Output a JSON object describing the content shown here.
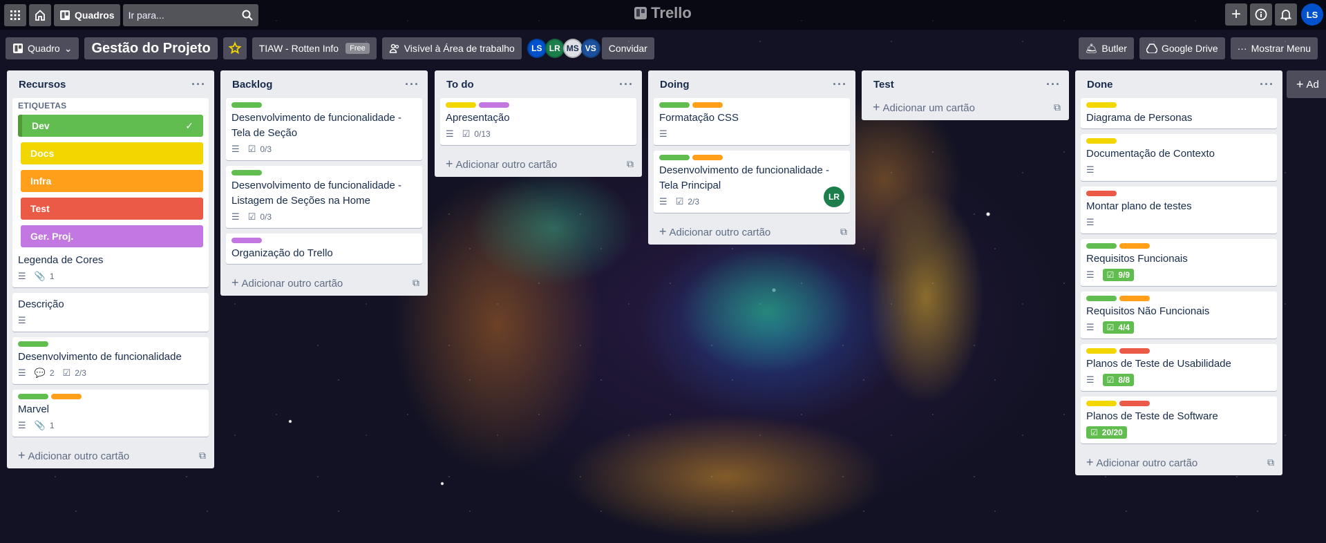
{
  "colors": {
    "green": "#61bd4f",
    "yellow": "#f2d600",
    "orange": "#ff9f1a",
    "red": "#eb5a46",
    "purple": "#c377e0"
  },
  "topbar": {
    "boards_label": "Quadros",
    "search_placeholder": "Ir para...",
    "logo": "Trello",
    "user_initials": "LS"
  },
  "boardbar": {
    "view_label": "Quadro",
    "title": "Gestão do Projeto",
    "team": "TIAW - Rotten Info",
    "team_badge": "Free",
    "visibility": "Visível à Área de trabalho",
    "invite": "Convidar",
    "members": [
      {
        "initials": "LS",
        "color": "#0052cc"
      },
      {
        "initials": "LR",
        "color": "#1b7e4b"
      },
      {
        "initials": "MS",
        "color": "#dfe1e6"
      },
      {
        "initials": "VS",
        "color": "#1c4f9c"
      }
    ],
    "butler": "Butler",
    "drive": "Google Drive",
    "menu": "Mostrar Menu"
  },
  "lists": {
    "recursos": {
      "title": "Recursos",
      "etiquetas": "ETIQUETAS",
      "tags": [
        "Dev",
        "Docs",
        "Infra",
        "Test",
        "Ger. Proj."
      ],
      "cards": [
        {
          "title": "Legenda de Cores",
          "attach": "1"
        },
        {
          "title": "Descrição"
        },
        {
          "title": "Desenvolvimento de funcionalidade",
          "attach": "2",
          "checklist": "2/3"
        },
        {
          "title": "Marvel",
          "attach": "1"
        }
      ],
      "add": "Adicionar outro cartão"
    },
    "backlog": {
      "title": "Backlog",
      "cards": [
        {
          "title": "Desenvolvimento de funcionalidade - Tela de Seção",
          "checklist": "0/3"
        },
        {
          "title": "Desenvolvimento de funcionalidade - Listagem de Seções na Home",
          "checklist": "0/3"
        },
        {
          "title": "Organização do Trello"
        }
      ],
      "add": "Adicionar outro cartão"
    },
    "todo": {
      "title": "To do",
      "cards": [
        {
          "title": "Apresentação",
          "checklist": "0/13"
        }
      ],
      "add": "Adicionar outro cartão"
    },
    "doing": {
      "title": "Doing",
      "cards": [
        {
          "title": "Formatação CSS"
        },
        {
          "title": "Desenvolvimento de funcionalidade - Tela Principal",
          "checklist": "2/3",
          "member": "LR"
        }
      ],
      "add": "Adicionar outro cartão"
    },
    "test": {
      "title": "Test",
      "add": "Adicionar um cartão"
    },
    "done": {
      "title": "Done",
      "cards": [
        {
          "title": "Diagrama de Personas"
        },
        {
          "title": "Documentação de Contexto"
        },
        {
          "title": "Montar plano de testes"
        },
        {
          "title": "Requisitos Funcionais",
          "checklist": "9/9"
        },
        {
          "title": "Requisitos Não Funcionais",
          "checklist": "4/4"
        },
        {
          "title": "Planos de Teste de Usabilidade",
          "checklist": "8/8"
        },
        {
          "title": "Planos de Teste de Software",
          "checklist": "20/20"
        }
      ],
      "add": "Adicionar outro cartão"
    }
  },
  "add_list": "Ad"
}
